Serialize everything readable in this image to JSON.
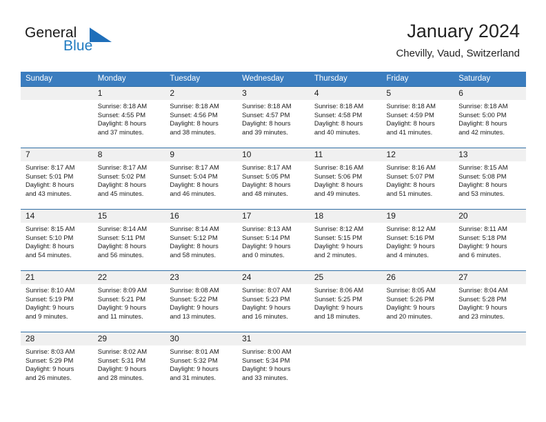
{
  "brand": {
    "name_part1": "General",
    "name_part2": "Blue",
    "flag_icon": "blue-triangle-flag-icon",
    "blue_hex": "#1f7ac0"
  },
  "header": {
    "title": "January 2024",
    "subtitle": "Chevilly, Vaud, Switzerland"
  },
  "theme": {
    "header_row_bg": "#3b7dbf",
    "week_separator": "#2e6da4",
    "daynumber_band_bg": "#f0f0f0",
    "text": "#1a1a1a"
  },
  "weekdays": [
    "Sunday",
    "Monday",
    "Tuesday",
    "Wednesday",
    "Thursday",
    "Friday",
    "Saturday"
  ],
  "weeks": [
    {
      "numbers": [
        "",
        "1",
        "2",
        "3",
        "4",
        "5",
        "6"
      ],
      "details": [
        {
          "l1": "",
          "l2": "",
          "l3": "",
          "l4": ""
        },
        {
          "l1": "Sunrise: 8:18 AM",
          "l2": "Sunset: 4:55 PM",
          "l3": "Daylight: 8 hours",
          "l4": "and 37 minutes."
        },
        {
          "l1": "Sunrise: 8:18 AM",
          "l2": "Sunset: 4:56 PM",
          "l3": "Daylight: 8 hours",
          "l4": "and 38 minutes."
        },
        {
          "l1": "Sunrise: 8:18 AM",
          "l2": "Sunset: 4:57 PM",
          "l3": "Daylight: 8 hours",
          "l4": "and 39 minutes."
        },
        {
          "l1": "Sunrise: 8:18 AM",
          "l2": "Sunset: 4:58 PM",
          "l3": "Daylight: 8 hours",
          "l4": "and 40 minutes."
        },
        {
          "l1": "Sunrise: 8:18 AM",
          "l2": "Sunset: 4:59 PM",
          "l3": "Daylight: 8 hours",
          "l4": "and 41 minutes."
        },
        {
          "l1": "Sunrise: 8:18 AM",
          "l2": "Sunset: 5:00 PM",
          "l3": "Daylight: 8 hours",
          "l4": "and 42 minutes."
        }
      ]
    },
    {
      "numbers": [
        "7",
        "8",
        "9",
        "10",
        "11",
        "12",
        "13"
      ],
      "details": [
        {
          "l1": "Sunrise: 8:17 AM",
          "l2": "Sunset: 5:01 PM",
          "l3": "Daylight: 8 hours",
          "l4": "and 43 minutes."
        },
        {
          "l1": "Sunrise: 8:17 AM",
          "l2": "Sunset: 5:02 PM",
          "l3": "Daylight: 8 hours",
          "l4": "and 45 minutes."
        },
        {
          "l1": "Sunrise: 8:17 AM",
          "l2": "Sunset: 5:04 PM",
          "l3": "Daylight: 8 hours",
          "l4": "and 46 minutes."
        },
        {
          "l1": "Sunrise: 8:17 AM",
          "l2": "Sunset: 5:05 PM",
          "l3": "Daylight: 8 hours",
          "l4": "and 48 minutes."
        },
        {
          "l1": "Sunrise: 8:16 AM",
          "l2": "Sunset: 5:06 PM",
          "l3": "Daylight: 8 hours",
          "l4": "and 49 minutes."
        },
        {
          "l1": "Sunrise: 8:16 AM",
          "l2": "Sunset: 5:07 PM",
          "l3": "Daylight: 8 hours",
          "l4": "and 51 minutes."
        },
        {
          "l1": "Sunrise: 8:15 AM",
          "l2": "Sunset: 5:08 PM",
          "l3": "Daylight: 8 hours",
          "l4": "and 53 minutes."
        }
      ]
    },
    {
      "numbers": [
        "14",
        "15",
        "16",
        "17",
        "18",
        "19",
        "20"
      ],
      "details": [
        {
          "l1": "Sunrise: 8:15 AM",
          "l2": "Sunset: 5:10 PM",
          "l3": "Daylight: 8 hours",
          "l4": "and 54 minutes."
        },
        {
          "l1": "Sunrise: 8:14 AM",
          "l2": "Sunset: 5:11 PM",
          "l3": "Daylight: 8 hours",
          "l4": "and 56 minutes."
        },
        {
          "l1": "Sunrise: 8:14 AM",
          "l2": "Sunset: 5:12 PM",
          "l3": "Daylight: 8 hours",
          "l4": "and 58 minutes."
        },
        {
          "l1": "Sunrise: 8:13 AM",
          "l2": "Sunset: 5:14 PM",
          "l3": "Daylight: 9 hours",
          "l4": "and 0 minutes."
        },
        {
          "l1": "Sunrise: 8:12 AM",
          "l2": "Sunset: 5:15 PM",
          "l3": "Daylight: 9 hours",
          "l4": "and 2 minutes."
        },
        {
          "l1": "Sunrise: 8:12 AM",
          "l2": "Sunset: 5:16 PM",
          "l3": "Daylight: 9 hours",
          "l4": "and 4 minutes."
        },
        {
          "l1": "Sunrise: 8:11 AM",
          "l2": "Sunset: 5:18 PM",
          "l3": "Daylight: 9 hours",
          "l4": "and 6 minutes."
        }
      ]
    },
    {
      "numbers": [
        "21",
        "22",
        "23",
        "24",
        "25",
        "26",
        "27"
      ],
      "details": [
        {
          "l1": "Sunrise: 8:10 AM",
          "l2": "Sunset: 5:19 PM",
          "l3": "Daylight: 9 hours",
          "l4": "and 9 minutes."
        },
        {
          "l1": "Sunrise: 8:09 AM",
          "l2": "Sunset: 5:21 PM",
          "l3": "Daylight: 9 hours",
          "l4": "and 11 minutes."
        },
        {
          "l1": "Sunrise: 8:08 AM",
          "l2": "Sunset: 5:22 PM",
          "l3": "Daylight: 9 hours",
          "l4": "and 13 minutes."
        },
        {
          "l1": "Sunrise: 8:07 AM",
          "l2": "Sunset: 5:23 PM",
          "l3": "Daylight: 9 hours",
          "l4": "and 16 minutes."
        },
        {
          "l1": "Sunrise: 8:06 AM",
          "l2": "Sunset: 5:25 PM",
          "l3": "Daylight: 9 hours",
          "l4": "and 18 minutes."
        },
        {
          "l1": "Sunrise: 8:05 AM",
          "l2": "Sunset: 5:26 PM",
          "l3": "Daylight: 9 hours",
          "l4": "and 20 minutes."
        },
        {
          "l1": "Sunrise: 8:04 AM",
          "l2": "Sunset: 5:28 PM",
          "l3": "Daylight: 9 hours",
          "l4": "and 23 minutes."
        }
      ]
    },
    {
      "numbers": [
        "28",
        "29",
        "30",
        "31",
        "",
        "",
        ""
      ],
      "details": [
        {
          "l1": "Sunrise: 8:03 AM",
          "l2": "Sunset: 5:29 PM",
          "l3": "Daylight: 9 hours",
          "l4": "and 26 minutes."
        },
        {
          "l1": "Sunrise: 8:02 AM",
          "l2": "Sunset: 5:31 PM",
          "l3": "Daylight: 9 hours",
          "l4": "and 28 minutes."
        },
        {
          "l1": "Sunrise: 8:01 AM",
          "l2": "Sunset: 5:32 PM",
          "l3": "Daylight: 9 hours",
          "l4": "and 31 minutes."
        },
        {
          "l1": "Sunrise: 8:00 AM",
          "l2": "Sunset: 5:34 PM",
          "l3": "Daylight: 9 hours",
          "l4": "and 33 minutes."
        },
        {
          "l1": "",
          "l2": "",
          "l3": "",
          "l4": ""
        },
        {
          "l1": "",
          "l2": "",
          "l3": "",
          "l4": ""
        },
        {
          "l1": "",
          "l2": "",
          "l3": "",
          "l4": ""
        }
      ]
    }
  ]
}
